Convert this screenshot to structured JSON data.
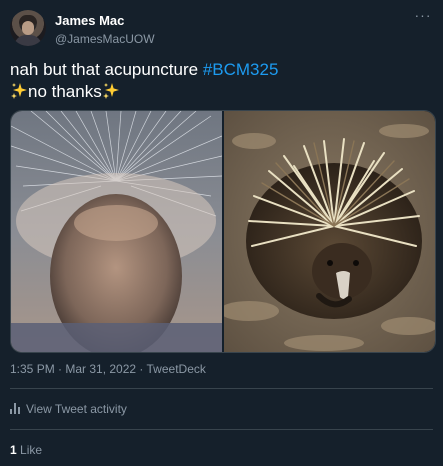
{
  "author": {
    "display_name": "James Mac",
    "handle": "@JamesMacUOW",
    "avatar_icon": "user-avatar"
  },
  "tweet": {
    "text_line1": "nah but that acupuncture ",
    "hashtag": "#BCM325",
    "text_line2": "no thanks",
    "timestamp": "1:35 PM · Mar 31, 2022 · TweetDeck"
  },
  "actions": {
    "view_activity_label": "View Tweet activity",
    "more_label": "···"
  },
  "stats": {
    "like_count": "1",
    "like_label": "Like"
  },
  "colors": {
    "background": "#15202b",
    "text": "#ffffff",
    "secondary": "#8b98a5",
    "link": "#1d9bf0",
    "border": "#38444d"
  }
}
